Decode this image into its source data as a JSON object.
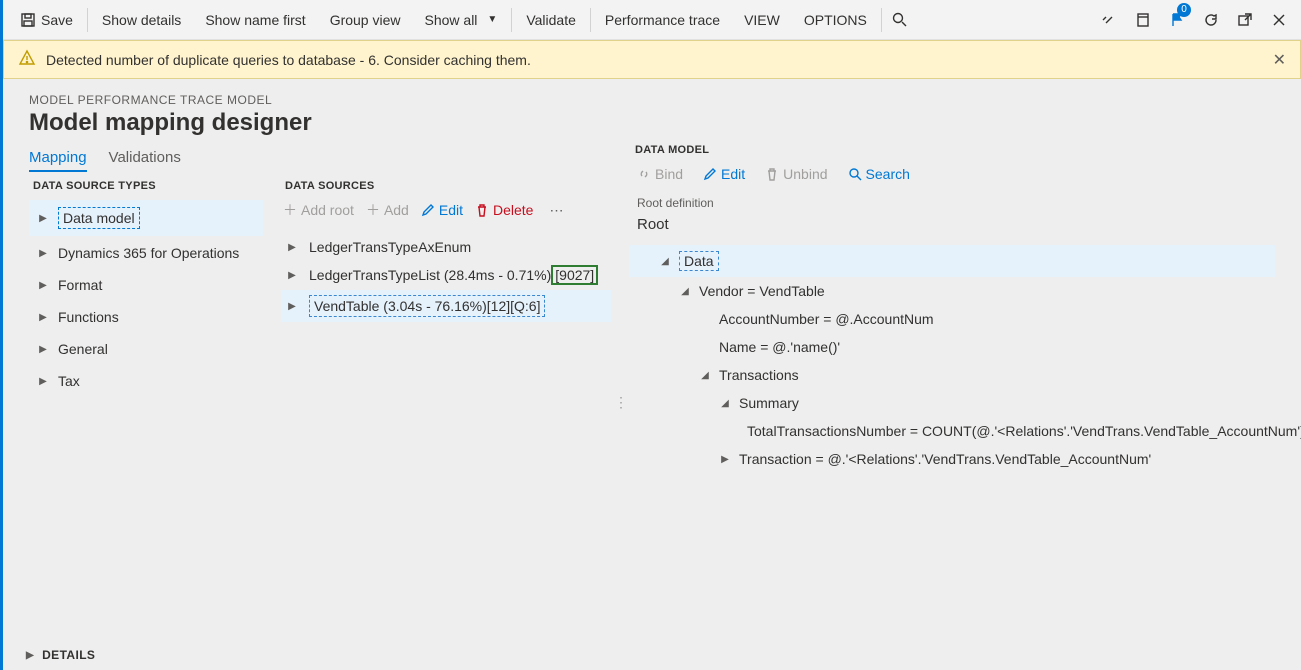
{
  "toolbar": {
    "save": "Save",
    "show_details": "Show details",
    "show_name_first": "Show name first",
    "group_view": "Group view",
    "show_all": "Show all",
    "validate": "Validate",
    "perf_trace": "Performance trace",
    "view": "VIEW",
    "options": "OPTIONS",
    "notif_badge": "0"
  },
  "banner": {
    "text": "Detected number of duplicate queries to database - 6. Consider caching them."
  },
  "header": {
    "breadcrumb": "MODEL PERFORMANCE TRACE MODEL",
    "title": "Model mapping designer"
  },
  "tabs": {
    "mapping": "Mapping",
    "validations": "Validations"
  },
  "dst": {
    "heading": "DATA SOURCE TYPES",
    "items": [
      "Data model",
      "Dynamics 365 for Operations",
      "Format",
      "Functions",
      "General",
      "Tax"
    ]
  },
  "ds": {
    "heading": "DATA SOURCES",
    "actions": {
      "add_root": "Add root",
      "add": "Add",
      "edit": "Edit",
      "delete": "Delete"
    },
    "rows": [
      {
        "label": "LedgerTransTypeAxEnum",
        "suffix": ""
      },
      {
        "label": "LedgerTransTypeList (28.4ms - 0.71%)",
        "suffix": "[9027]"
      },
      {
        "label": "VendTable (3.04s - 76.16%)[12][Q:6]",
        "suffix": ""
      }
    ]
  },
  "dm": {
    "heading": "DATA MODEL",
    "actions": {
      "bind": "Bind",
      "edit": "Edit",
      "unbind": "Unbind",
      "search": "Search"
    },
    "root_label": "Root definition",
    "root_value": "Root",
    "tree": {
      "data": "Data",
      "vendor": "Vendor = VendTable",
      "account": "AccountNumber = @.AccountNum",
      "name": "Name = @.'name()'",
      "transactions": "Transactions",
      "summary": "Summary",
      "total": "TotalTransactionsNumber = COUNT(@.'<Relations'.'VendTrans.VendTable_AccountNum')",
      "transaction": "Transaction = @.'<Relations'.'VendTrans.VendTable_AccountNum'"
    }
  },
  "details": "DETAILS"
}
